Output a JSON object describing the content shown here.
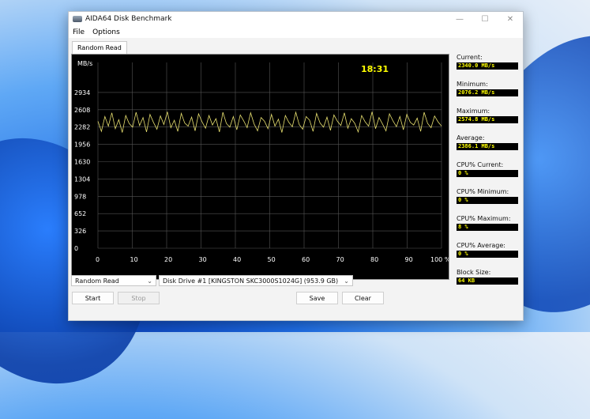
{
  "window": {
    "title": "AIDA64 Disk Benchmark",
    "controls": [
      "—",
      "☐",
      "✕"
    ]
  },
  "menu": [
    "File",
    "Options"
  ],
  "tab": "Random Read",
  "graph": {
    "unit": "MB/s",
    "timer": "18:31",
    "y_ticks": [
      "2934",
      "2608",
      "2282",
      "1956",
      "1630",
      "1304",
      "978",
      "652",
      "326",
      "0"
    ],
    "x_ticks": [
      "0",
      "10",
      "20",
      "30",
      "40",
      "50",
      "60",
      "70",
      "80",
      "90",
      "100 %"
    ]
  },
  "chart_data": {
    "type": "line",
    "series": [
      {
        "values": [
          2390,
          2200,
          2480,
          2300,
          2550,
          2250,
          2420,
          2180,
          2500,
          2350,
          2280,
          2560,
          2310,
          2460,
          2190,
          2520,
          2370,
          2240,
          2490,
          2330,
          2570,
          2270,
          2410,
          2200,
          2540,
          2360,
          2300,
          2470,
          2210,
          2530,
          2380,
          2260,
          2500,
          2320,
          2440,
          2190,
          2560,
          2350,
          2280,
          2480,
          2230,
          2510,
          2400,
          2270,
          2550,
          2340,
          2210,
          2460,
          2390,
          2250,
          2520,
          2300,
          2430,
          2180,
          2500,
          2370,
          2290,
          2560,
          2330,
          2240,
          2480,
          2410,
          2200,
          2540,
          2360,
          2280,
          2470,
          2220,
          2510,
          2390,
          2310,
          2550,
          2260,
          2440,
          2350,
          2190,
          2500,
          2380,
          2300,
          2570,
          2250,
          2460,
          2340,
          2210,
          2530,
          2400,
          2290,
          2480,
          2230,
          2520,
          2370,
          2320,
          2450,
          2200,
          2560,
          2350,
          2270,
          2490,
          2380,
          2300
        ]
      }
    ],
    "xlim": [
      0,
      100
    ],
    "ylim": [
      0,
      3260
    ]
  },
  "stats": [
    {
      "label": "Current:",
      "value": "2340.0 MB/s"
    },
    {
      "label": "Minimum:",
      "value": "2076.2 MB/s"
    },
    {
      "label": "Maximum:",
      "value": "2574.8 MB/s"
    },
    {
      "label": "Average:",
      "value": "2386.1 MB/s"
    },
    {
      "label": "CPU% Current:",
      "value": "0 %"
    },
    {
      "label": "CPU% Minimum:",
      "value": "0 %"
    },
    {
      "label": "CPU% Maximum:",
      "value": "8 %"
    },
    {
      "label": "CPU% Average:",
      "value": "0 %"
    },
    {
      "label": "Block Size:",
      "value": "64 KB"
    }
  ],
  "controls": {
    "test_select": "Random Read",
    "drive_select": "Disk Drive #1  [KINGSTON SKC3000S1024G]  (953.9 GB)",
    "start": "Start",
    "stop": "Stop",
    "save": "Save",
    "clear": "Clear"
  },
  "colors": {
    "series": "#e8e070",
    "timer": "#ffff00",
    "grid": "#555555",
    "text": "#ffffff"
  }
}
